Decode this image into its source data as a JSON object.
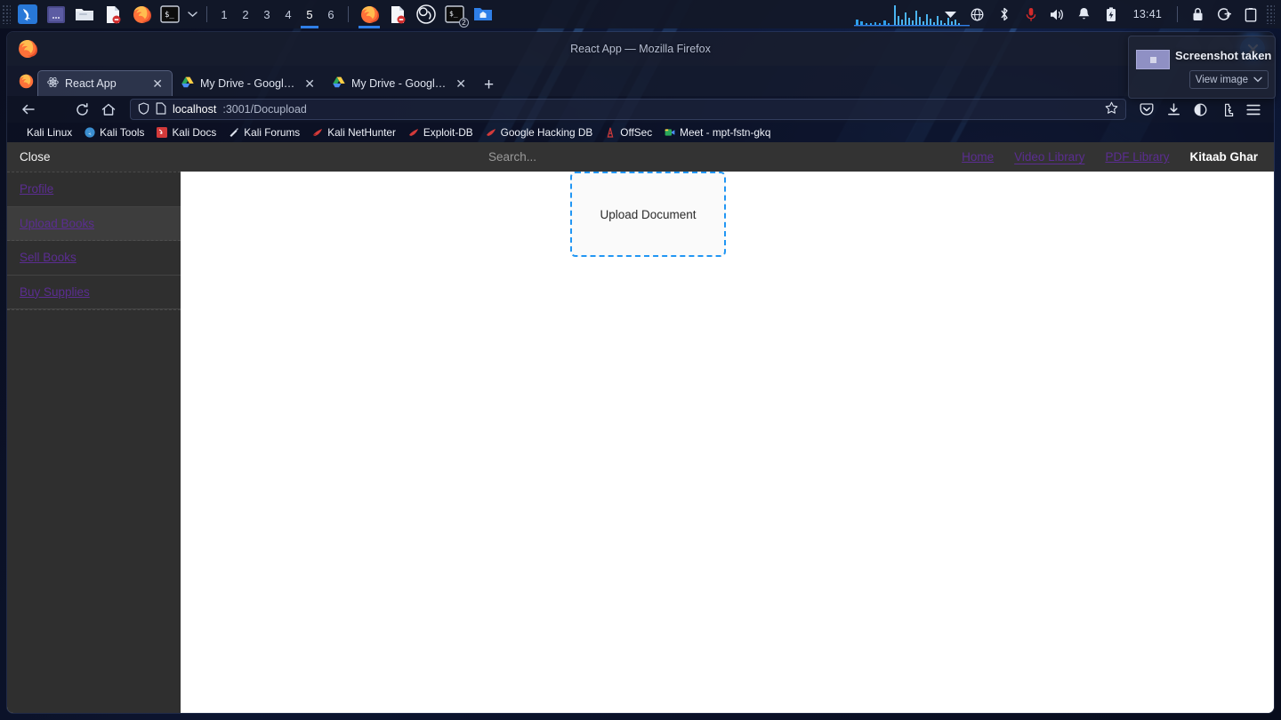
{
  "taskbar": {
    "apps_left": [
      {
        "name": "kali-menu-icon",
        "label": "Kali Menu"
      },
      {
        "name": "terminal-purple-icon",
        "label": "Terminal"
      },
      {
        "name": "files-icon",
        "label": "Files"
      },
      {
        "name": "text-editor-icon",
        "label": "Text Editor"
      },
      {
        "name": "firefox-icon",
        "label": "Firefox"
      },
      {
        "name": "terminal-icon",
        "label": "Terminal"
      }
    ],
    "workspaces": [
      "1",
      "2",
      "3",
      "4",
      "5",
      "6"
    ],
    "active_workspace": "5",
    "apps_open": [
      {
        "name": "firefox-window-icon",
        "label": "Firefox"
      },
      {
        "name": "document-window-icon",
        "label": "Document"
      },
      {
        "name": "obs-window-icon",
        "label": "OBS Studio"
      },
      {
        "name": "terminal-window-icon",
        "label": "Terminal",
        "badge": "2"
      },
      {
        "name": "files-window-icon",
        "label": "Files"
      }
    ],
    "tray": [
      {
        "name": "network-wifi-icon"
      },
      {
        "name": "globe-icon"
      },
      {
        "name": "bluetooth-icon"
      },
      {
        "name": "microphone-icon"
      },
      {
        "name": "volume-icon"
      },
      {
        "name": "notification-bell-icon"
      },
      {
        "name": "battery-icon"
      }
    ],
    "clock": "13:41",
    "tray_right": [
      {
        "name": "lock-icon"
      },
      {
        "name": "logout-icon"
      },
      {
        "name": "clipboard-icon"
      }
    ]
  },
  "window": {
    "title": "React App — Mozilla Firefox"
  },
  "browser": {
    "tabs": [
      {
        "title": "React App",
        "favicon": "react-icon",
        "selected": true
      },
      {
        "title": "My Drive - Google Drive",
        "favicon": "google-drive-icon",
        "selected": false
      },
      {
        "title": "My Drive - Google Drive",
        "favicon": "google-drive-icon",
        "selected": false
      }
    ],
    "new_tab_label": "+",
    "url_host": "localhost",
    "url_path": ":3001/Docupload",
    "toolbar_right": [
      {
        "name": "pocket-save-icon"
      },
      {
        "name": "downloads-icon"
      },
      {
        "name": "account-icon"
      },
      {
        "name": "extensions-icon"
      },
      {
        "name": "app-menu-icon"
      }
    ],
    "bookmarks": [
      {
        "label": "Kali Linux",
        "icon": "none"
      },
      {
        "label": "Kali Tools",
        "icon": "kali-tools-icon"
      },
      {
        "label": "Kali Docs",
        "icon": "kali-docs-icon"
      },
      {
        "label": "Kali Forums",
        "icon": "kali-forums-icon"
      },
      {
        "label": "Kali NetHunter",
        "icon": "nethunter-icon"
      },
      {
        "label": "Exploit-DB",
        "icon": "exploitdb-icon"
      },
      {
        "label": "Google Hacking DB",
        "icon": "ghdb-icon"
      },
      {
        "label": "OffSec",
        "icon": "offsec-icon"
      },
      {
        "label": "Meet - mpt-fstn-gkq",
        "icon": "google-meet-icon"
      }
    ]
  },
  "app": {
    "close_label": "Close",
    "search_placeholder": "Search...",
    "nav_links": [
      {
        "label": "Home",
        "current": false
      },
      {
        "label": "Video Library",
        "current": true
      },
      {
        "label": "PDF Library",
        "current": false
      }
    ],
    "brand": "Kitaab Ghar",
    "sidebar_items": [
      {
        "label": "Profile",
        "highlighted": false
      },
      {
        "label": "Upload Books",
        "highlighted": true
      },
      {
        "label": "Sell Books",
        "highlighted": false
      },
      {
        "label": "Buy Supplies",
        "highlighted": false
      }
    ],
    "dropzone_label": "Upload Document"
  },
  "notification": {
    "title": "Screenshot taken",
    "action_label": "View image",
    "thumbnail": "screenshot-thumbnail"
  },
  "colors": {
    "accent_blue": "#2196f3",
    "link_purple": "#5b2d91",
    "sidebar_bg": "#2f2f2f",
    "navbar_bg": "#333333",
    "taskbar_active": "#2f7fe8"
  }
}
